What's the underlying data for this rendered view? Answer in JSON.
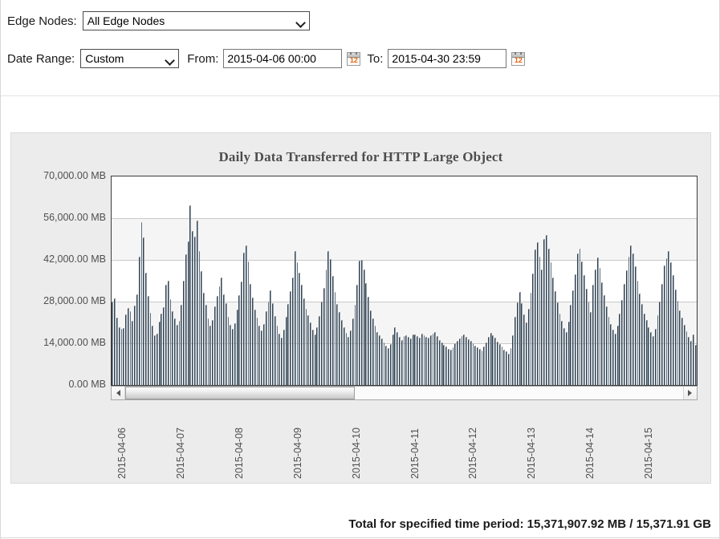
{
  "controls": {
    "edge_nodes": {
      "label": "Edge Nodes:",
      "value": "All Edge Nodes",
      "options": [
        "All Edge Nodes"
      ]
    },
    "date_range": {
      "label": "Date Range:",
      "value": "Custom",
      "options": [
        "Custom"
      ]
    },
    "from": {
      "label": "From:",
      "value": "2015-04-06 00:00",
      "calendar_icon": "calendar-icon",
      "calendar_day": "12"
    },
    "to": {
      "label": "To:",
      "value": "2015-04-30 23:59",
      "calendar_icon": "calendar-icon",
      "calendar_day": "12"
    }
  },
  "chart_data": {
    "type": "bar",
    "title": "Daily Data Transferred for HTTP Large Object",
    "xlabel": "",
    "ylabel": "",
    "ylim": [
      0,
      70000
    ],
    "yticks": [
      0,
      14000,
      28000,
      42000,
      56000,
      70000
    ],
    "ytick_labels": [
      "0.00 MB",
      "14,000.00 MB",
      "28,000.00 MB",
      "42,000.00 MB",
      "56,000.00 MB",
      "70,000.00 MB"
    ],
    "unit": "MB",
    "grid": true,
    "legend": null,
    "xtick_labels": [
      "2015-04-06",
      "2015-04-07",
      "2015-04-08",
      "2015-04-09",
      "2015-04-10",
      "2015-04-11",
      "2015-04-12",
      "2015-04-13",
      "2015-04-14",
      "2015-04-15"
    ],
    "bar_color": "#3f6280",
    "series": [
      {
        "name": "Data Transferred",
        "values": [
          27900,
          29100,
          22500,
          19400,
          18900,
          19200,
          23600,
          25900,
          24800,
          21600,
          26700,
          30500,
          43000,
          54700,
          49600,
          37800,
          29900,
          24300,
          19800,
          16700,
          17200,
          21400,
          24000,
          26200,
          33600,
          35100,
          28900,
          24700,
          22300,
          20100,
          21500,
          26800,
          34900,
          43800,
          48100,
          60300,
          51600,
          49900,
          55100,
          45000,
          38200,
          31100,
          26900,
          22400,
          19800,
          21900,
          26400,
          29800,
          33100,
          36200,
          30400,
          27600,
          22900,
          20100,
          18800,
          20700,
          25300,
          30100,
          34700,
          44500,
          46900,
          41500,
          33800,
          29400,
          25200,
          22700,
          19900,
          18300,
          20600,
          24800,
          28100,
          31900,
          27400,
          23100,
          19800,
          17200,
          15900,
          18600,
          22900,
          27300,
          31400,
          36000,
          44900,
          41200,
          37800,
          33600,
          29100,
          25700,
          23400,
          21000,
          18700,
          17100,
          19300,
          23200,
          27900,
          32500,
          38800,
          45100,
          42300,
          36700,
          31200,
          27100,
          24600,
          21800,
          19400,
          17600,
          16200,
          18300,
          22400,
          26900,
          33700,
          41800,
          42100,
          38900,
          34200,
          29700,
          25100,
          22300,
          19800,
          17900,
          16800,
          15600,
          14200,
          13100,
          12400,
          13800,
          16900,
          19400,
          17800,
          16200,
          15100,
          16400,
          16800,
          16100,
          15700,
          16900,
          17100,
          16400,
          15900,
          17300,
          16800,
          16200,
          15800,
          16700,
          17200,
          17900,
          16400,
          15100,
          14300,
          13600,
          12900,
          12100,
          11800,
          12700,
          13900,
          14800,
          15600,
          16300,
          16900,
          16200,
          15400,
          14700,
          13900,
          13200,
          12600,
          12100,
          11700,
          12900,
          14300,
          16100,
          17400,
          16800,
          15900,
          14600,
          13700,
          12800,
          11900,
          11200,
          10600,
          12400,
          16700,
          22900,
          27800,
          31200,
          27400,
          23800,
          21100,
          25600,
          30900,
          37400,
          45600,
          47900,
          43200,
          38700,
          48900,
          50300,
          45800,
          41100,
          36200,
          31400,
          27800,
          24100,
          21600,
          19200,
          17800,
          21400,
          26900,
          31800,
          37200,
          44100,
          45800,
          41600,
          36900,
          32400,
          28100,
          24600,
          33700,
          38900,
          42800,
          39200,
          34600,
          30100,
          26400,
          22900,
          20600,
          18700,
          17300,
          19800,
          24100,
          28600,
          33900,
          38400,
          43100,
          46800,
          44200,
          39800,
          35100,
          30600,
          27300,
          24100,
          21700,
          19300,
          17800,
          16400,
          18900,
          23400,
          28100,
          33800,
          40100,
          42600,
          44900,
          41300,
          36800,
          32100,
          28400,
          25100,
          22600,
          20300,
          18100,
          16200,
          14800,
          16900,
          13400
        ]
      }
    ]
  },
  "scrollbar": {
    "left_arrow_icon": "triangle-left-icon",
    "right_arrow_icon": "triangle-right-icon",
    "thumb_fraction": 0.412
  },
  "footer": {
    "total_text": "Total for specified time period: 15,371,907.92 MB / 15,371.91 GB"
  }
}
